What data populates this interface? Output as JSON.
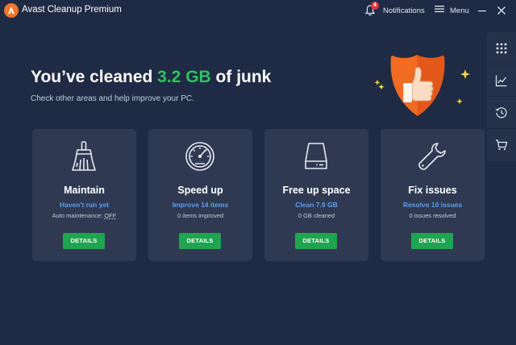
{
  "app": {
    "title": "Avast Cleanup Premium",
    "notifications_label": "Notifications",
    "notifications_count": "4",
    "menu_label": "Menu"
  },
  "hero": {
    "title_prefix": "You’ve cleaned ",
    "title_amount": "3.2 GB",
    "title_suffix": " of junk",
    "subtitle": "Check other areas and help improve your PC."
  },
  "rail": {
    "items": [
      {
        "icon": "grid-icon"
      },
      {
        "icon": "chart-icon"
      },
      {
        "icon": "history-icon"
      },
      {
        "icon": "cart-icon"
      }
    ]
  },
  "cards": [
    {
      "title": "Maintain",
      "status": "Haven't run yet",
      "sub_prefix": "Auto maintenance: ",
      "sub_value": "OFF",
      "button": "DETAILS",
      "icon": "broom-icon"
    },
    {
      "title": "Speed up",
      "status": "Improve 14 items",
      "sub": "0 items improved",
      "button": "DETAILS",
      "icon": "speedometer-icon"
    },
    {
      "title": "Free up space",
      "status": "Clean 7.9 GB",
      "sub": "0 GB cleaned",
      "button": "DETAILS",
      "icon": "hard-drive-icon"
    },
    {
      "title": "Fix issues",
      "status": "Resolve 10 issues",
      "sub": "0 issues resolved",
      "button": "DETAILS",
      "icon": "wrench-icon"
    }
  ],
  "colors": {
    "background": "#1f2b44",
    "card": "#2f3a52",
    "accent_green": "#2dc262",
    "button_green": "#21a451",
    "link_blue": "#5a9ef4",
    "brand_orange": "#f2752a"
  }
}
